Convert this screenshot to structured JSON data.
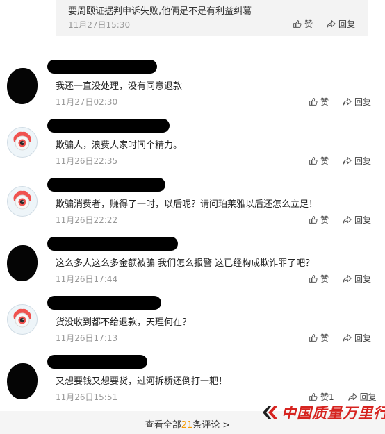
{
  "quoted_reply": {
    "text": "要周颐证据判申诉失败,他俩是不是有利益纠葛",
    "time": "11月27日15:30",
    "like_label": "赞",
    "reply_label": "回复"
  },
  "comments": [
    {
      "avatar": "redacted",
      "text": "我还一直没处理，没有同意退款",
      "time": "11月27日02:30",
      "like_label": "赞",
      "reply_label": "回复"
    },
    {
      "avatar": "default",
      "text": "欺骗人，浪费人家时间个精力。",
      "time": "11月26日22:35",
      "like_label": "赞",
      "reply_label": "回复"
    },
    {
      "avatar": "default",
      "text": "欺骗消费者，赚得了一时，以后呢？请问珀莱雅以后还怎么立足！",
      "time": "11月26日22:22",
      "like_label": "赞",
      "reply_label": "回复"
    },
    {
      "avatar": "redacted",
      "text": "这么多人这么多金额被骗 我们怎么报警 这已经构成欺诈罪了吧？",
      "time": "11月26日17:44",
      "like_label": "赞",
      "reply_label": "回复"
    },
    {
      "avatar": "default",
      "text": "货没收到都不给退款，天理何在？",
      "time": "11月26日17:13",
      "like_label": "赞",
      "reply_label": "回复"
    },
    {
      "avatar": "redacted",
      "text": "又想要钱又想要货，过河拆桥还倒打一耙！",
      "time": "11月26日15:51",
      "like_label": "赞1",
      "reply_label": "回复"
    }
  ],
  "footer": {
    "view_all_prefix": "查看全部",
    "view_all_count": "21",
    "view_all_suffix": "条评论 >"
  },
  "watermark": {
    "text": "中国质量万里行",
    "color": "#d6231f"
  },
  "colors": {
    "accent_count": "#f59b00",
    "meta_gray": "#999999"
  }
}
